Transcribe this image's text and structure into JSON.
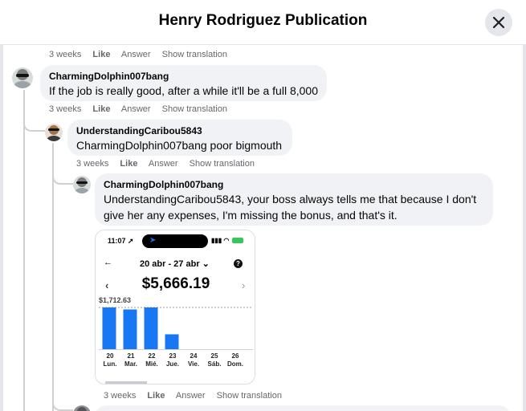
{
  "header": {
    "title": "Henry Rodriguez Publication"
  },
  "top_actions": {
    "time": "3 weeks",
    "like": "Like",
    "answer": "Answer",
    "translate": "Show translation"
  },
  "comments": [
    {
      "author": "CharmingDolphin007bang",
      "text": "If the job is really good, after a while it'll be a full 8,000",
      "actions": {
        "time": "3 weeks",
        "like": "Like",
        "answer": "Answer",
        "translate": "Show translation"
      }
    },
    {
      "author": "UnderstandingCaribou5843",
      "text": "CharmingDolphin007bang poor bigmouth",
      "actions": {
        "time": "3 weeks",
        "like": "Like",
        "answer": "Answer",
        "translate": "Show translation"
      }
    },
    {
      "author": "CharmingDolphin007bang",
      "text_line1": "UnderstandingCaribou5843, your boss always tells me that because I don't",
      "text_line2": "give her any expenses, I'm missing the bonus, and that's it.",
      "actions": {
        "time": "3 weeks",
        "like": "Like",
        "answer": "Answer",
        "translate": "Show translation"
      }
    }
  ],
  "screenshot": {
    "status_time": "11:07",
    "date_range": "20 abr - 27 abr",
    "total": "$5,666.19",
    "max_label": "$1,712.63",
    "chart_data": {
      "type": "bar",
      "categories": [
        "20 Lun.",
        "21 Mar.",
        "22 Mié.",
        "23 Jue.",
        "24 Vie.",
        "25 Sáb.",
        "26 Dom."
      ],
      "values": [
        1712.63,
        1630,
        1712.63,
        610,
        0,
        0,
        0
      ],
      "ylim": [
        0,
        1712.63
      ],
      "grid": false
    },
    "days": [
      {
        "num": "20",
        "name": "Lun."
      },
      {
        "num": "21",
        "name": "Mar."
      },
      {
        "num": "22",
        "name": "Mié."
      },
      {
        "num": "23",
        "name": "Jue."
      },
      {
        "num": "24",
        "name": "Vie."
      },
      {
        "num": "25",
        "name": "Sáb."
      },
      {
        "num": "26",
        "name": "Dom."
      }
    ],
    "bar_color": "#1877f2"
  },
  "icons": {
    "close": "close-icon",
    "back": "back-arrow-icon",
    "help": "help-icon"
  }
}
